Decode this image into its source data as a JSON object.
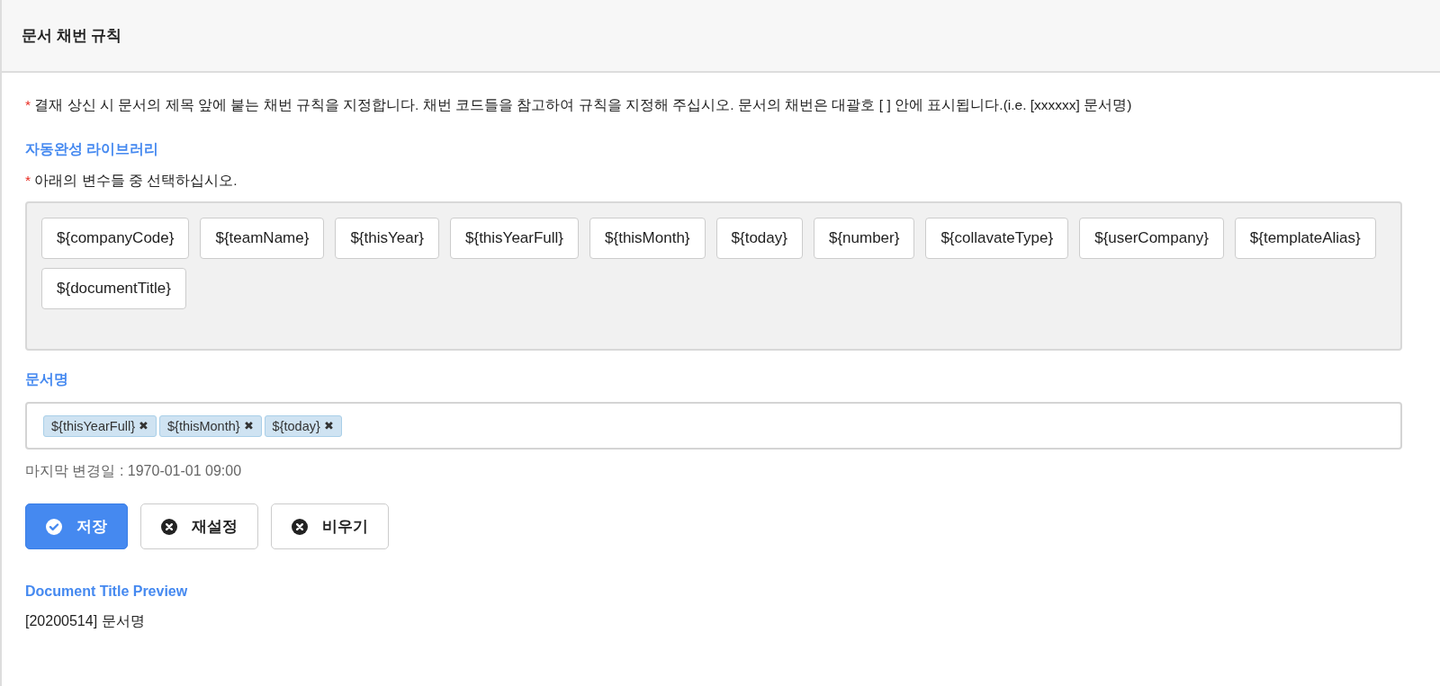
{
  "header": {
    "title": "문서 채번 규칙"
  },
  "notice": {
    "marker": "*",
    "text": "결재 상신 시 문서의 제목 앞에 붙는 채번 규칙을 지정합니다. 채번 코드들을 참고하여 규칙을 지정해 주십시오. 문서의 채번은 대괄호 [ ] 안에 표시됩니다.(i.e. [xxxxxx] 문서명)"
  },
  "library": {
    "heading": "자동완성 라이브러리",
    "hint_marker": "*",
    "hint": "아래의 변수들 중 선택하십시오.",
    "variables": [
      "${companyCode}",
      "${teamName}",
      "${thisYear}",
      "${thisYearFull}",
      "${thisMonth}",
      "${today}",
      "${number}",
      "${collavateType}",
      "${userCompany}",
      "${templateAlias}",
      "${documentTitle}"
    ]
  },
  "title_field": {
    "label": "문서명",
    "tags": [
      {
        "text": "${thisYearFull}",
        "remove": "✖"
      },
      {
        "text": "${thisMonth}",
        "remove": "✖"
      },
      {
        "text": "${today}",
        "remove": "✖"
      }
    ]
  },
  "last_modified": "마지막 변경일 : 1970-01-01 09:00",
  "buttons": [
    {
      "label": "저장",
      "kind": "primary"
    },
    {
      "label": "재설정",
      "kind": "default"
    },
    {
      "label": "비우기",
      "kind": "default"
    }
  ],
  "preview": {
    "heading": "Document Title Preview",
    "value": "[20200514] 문서명"
  }
}
